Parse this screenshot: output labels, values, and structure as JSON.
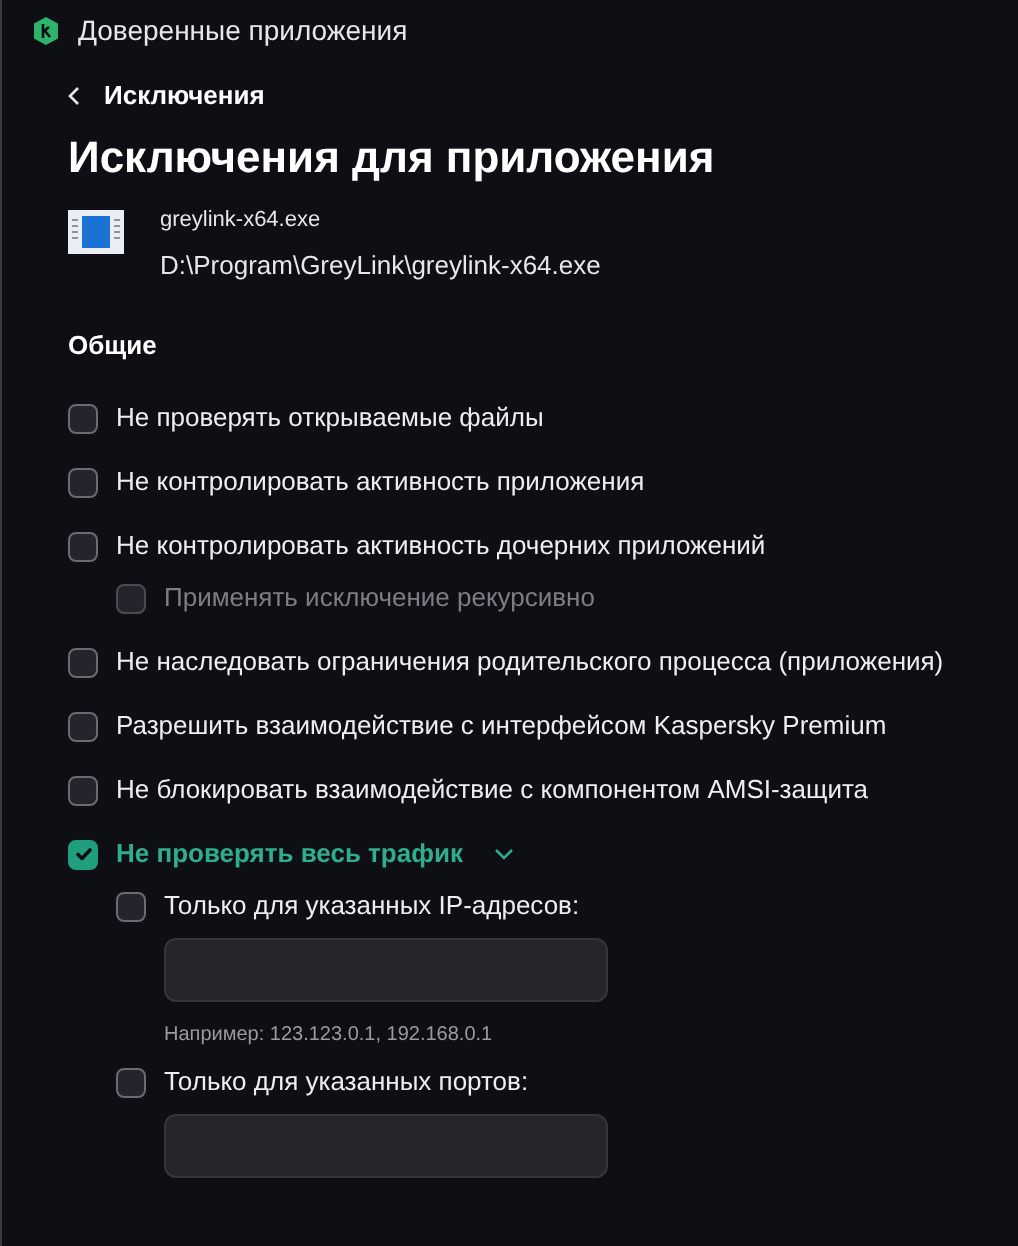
{
  "window": {
    "title": "Доверенные приложения"
  },
  "back_link": "Исключения",
  "heading": "Исключения для приложения",
  "app": {
    "name": "greylink-x64.exe",
    "path": "D:\\Program\\GreyLink\\greylink-x64.exe"
  },
  "section": "Общие",
  "options": [
    {
      "kind": "checkbox",
      "label": "Не проверять открываемые файлы",
      "checked": false,
      "disabled": false
    },
    {
      "kind": "checkbox",
      "label": "Не контролировать активность приложения",
      "checked": false,
      "disabled": false
    },
    {
      "kind": "checkbox",
      "label": "Не контролировать активность дочерних приложений",
      "checked": false,
      "disabled": false,
      "children": [
        {
          "kind": "checkbox",
          "label": "Применять исключение рекурсивно",
          "checked": false,
          "disabled": true
        }
      ]
    },
    {
      "kind": "checkbox",
      "label": "Не наследовать ограничения родительского процесса (приложения)",
      "checked": false,
      "disabled": false
    },
    {
      "kind": "checkbox",
      "label": "Разрешить взаимодействие с интерфейсом Kaspersky Premium",
      "checked": false,
      "disabled": false
    },
    {
      "kind": "checkbox",
      "label": "Не блокировать взаимодействие с компонентом AMSI-защита",
      "checked": false,
      "disabled": false
    },
    {
      "kind": "checkbox",
      "label": "Не проверять весь трафик",
      "checked": true,
      "disabled": false,
      "expanded": true,
      "children": [
        {
          "kind": "field",
          "label": "Только для указанных IP-адресов:",
          "checked": false,
          "disabled": false,
          "hint": "Например: 123.123.0.1, 192.168.0.1"
        },
        {
          "kind": "field",
          "label": "Только для указанных портов:",
          "checked": false,
          "disabled": false
        }
      ]
    }
  ]
}
